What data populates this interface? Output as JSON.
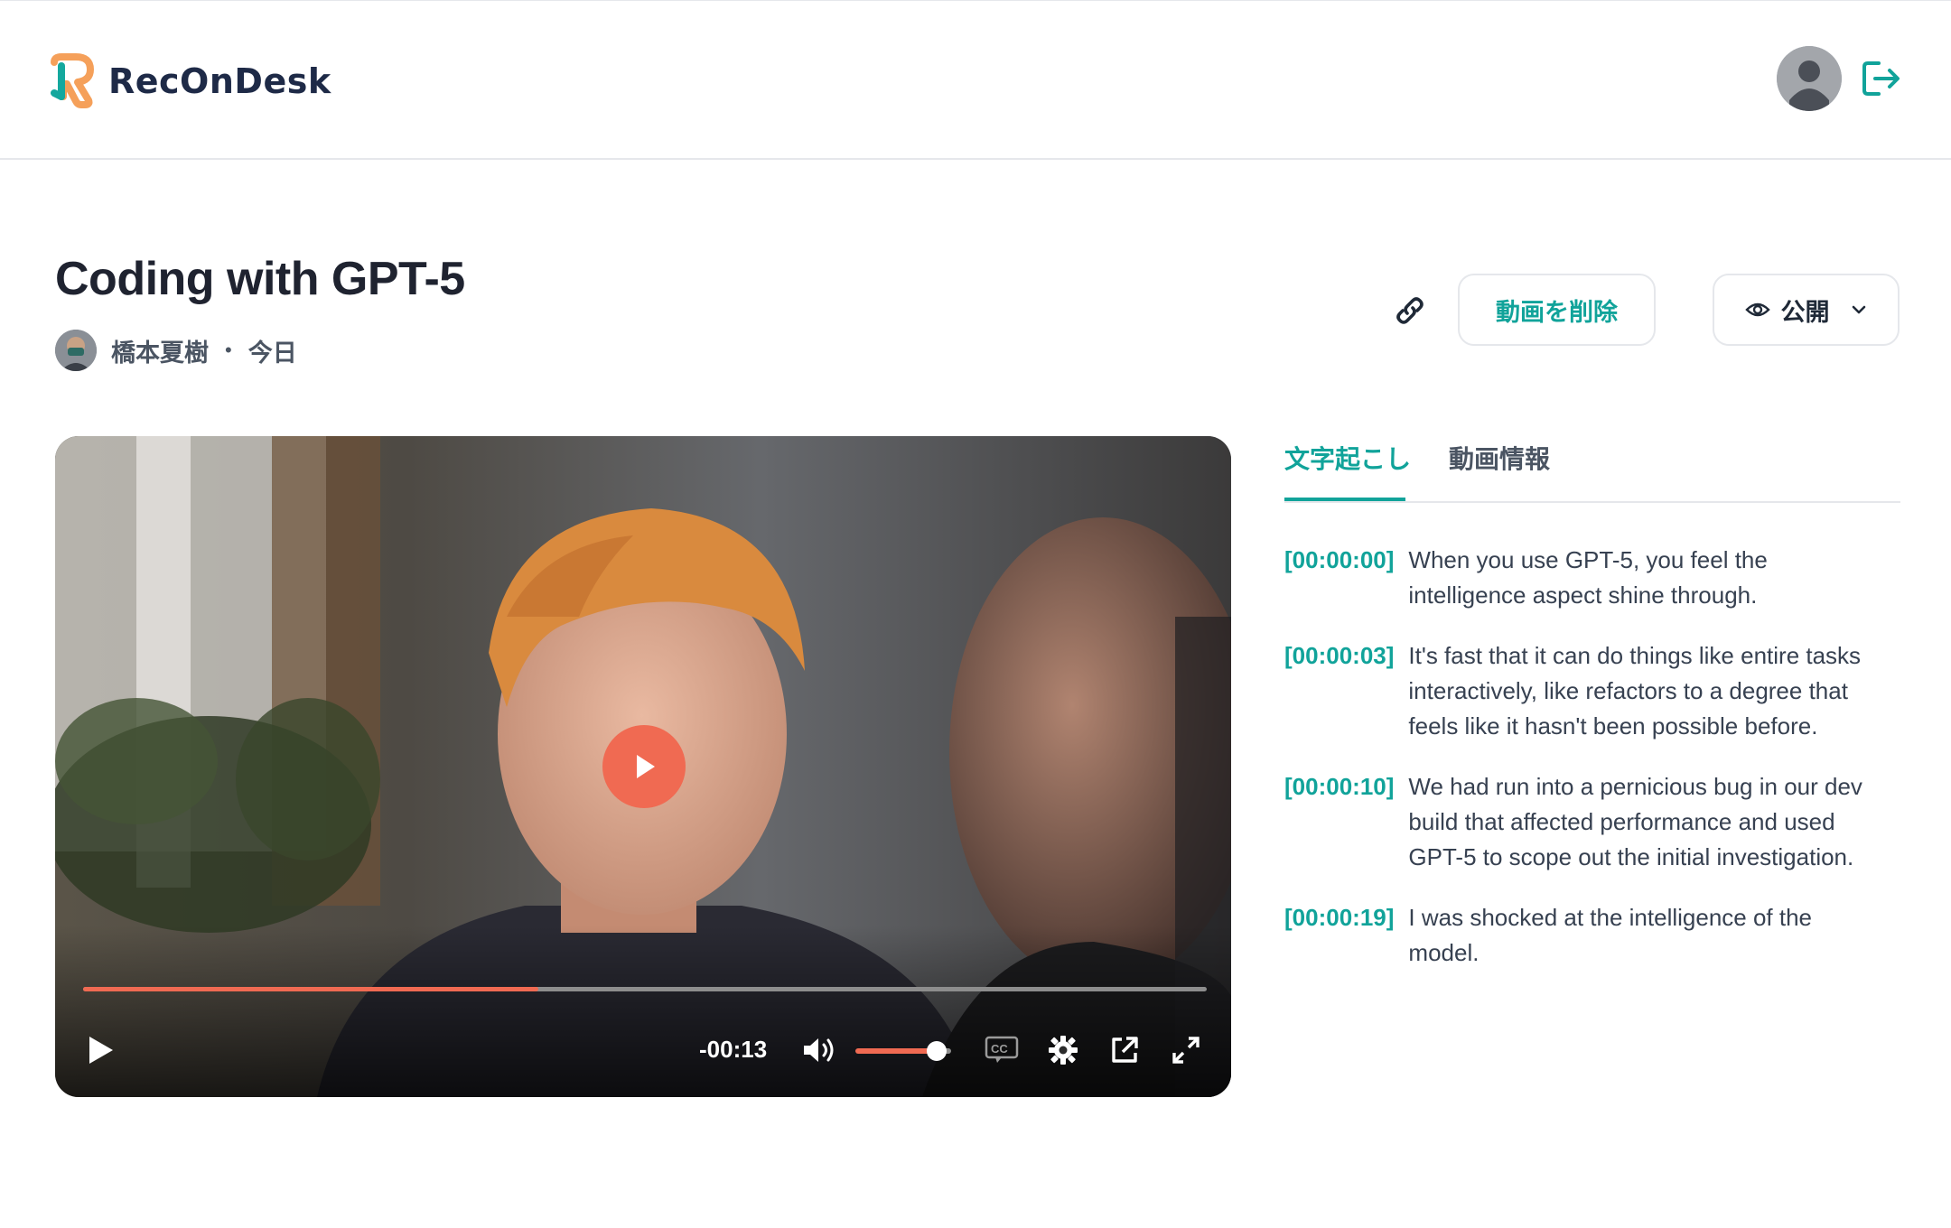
{
  "header": {
    "app_name": "RecOnDesk",
    "logo_icon": "reconDesk-logo-icon",
    "user_icon": "user-avatar-icon",
    "logout_icon": "logout-icon"
  },
  "video_meta": {
    "title": "Coding with GPT-5",
    "author": "橋本夏樹",
    "separator": "•",
    "date": "今日"
  },
  "actions": {
    "copy_link_icon": "link-icon",
    "delete_label": "動画を削除",
    "visibility_label": "公開",
    "visibility_icon": "eye-icon",
    "dropdown_icon": "chevron-down-icon"
  },
  "player": {
    "time_remaining": "-00:13",
    "progress": 0.405,
    "volume": 0.85,
    "accent_color": "#f06a52"
  },
  "panel": {
    "tabs": [
      {
        "label": "文字起こし",
        "active": true
      },
      {
        "label": "動画情報",
        "active": false
      }
    ],
    "transcript": [
      {
        "time": "[00:00:00]",
        "text": "When you use GPT-5, you feel the intelligence aspect shine through."
      },
      {
        "time": "[00:00:03]",
        "text": "It's fast that it can do things like entire tasks interactively, like refactors to a degree that feels like it hasn't been possible before."
      },
      {
        "time": "[00:00:10]",
        "text": "We had run into a pernicious bug in our dev build that affected performance and used GPT-5 to scope out the initial investigation."
      },
      {
        "time": "[00:00:19]",
        "text": "I was shocked at the intelligence of the model."
      }
    ]
  },
  "colors": {
    "teal": "#11a39a",
    "brand_navy": "#1e2a47",
    "logo_orange": "#f5a05a"
  }
}
